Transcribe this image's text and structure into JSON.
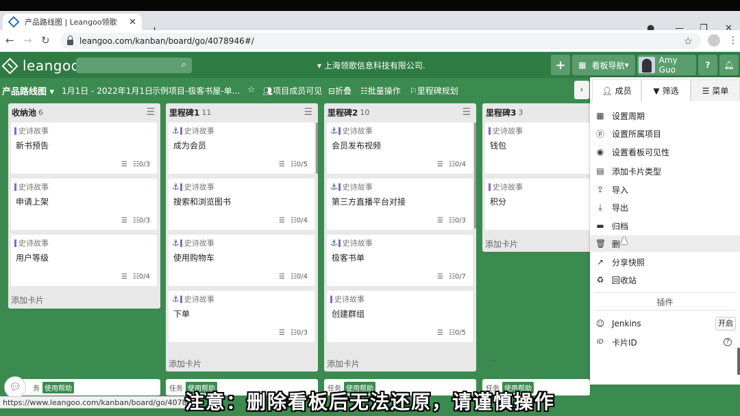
{
  "browser": {
    "tab_title": "产品路线图 | Leangoo领歌",
    "url": "leangoo.com/kanban/board/go/4078946#/",
    "status_url": "https://www.leangoo.com/kanban/board/go/40789"
  },
  "header": {
    "logo_text": "leangoo",
    "company": "上海领歌信息科技有限公司.",
    "board_nav_label": "看板导航",
    "user_name": "Amy Guo"
  },
  "subbar": {
    "board_title": "产品路线图",
    "date_range": "1月1日 - 2022年1月1日",
    "project": "示例项目-极客书屋-单...",
    "members_visible": "项目成员可见",
    "fold": "折叠",
    "batch": "批量操作",
    "milestone": "里程碑规划"
  },
  "columns": [
    {
      "name": "收纳池",
      "count": "6",
      "cards": [
        {
          "tag": "史诗故事",
          "title": "新书预告",
          "tasks": "0/3",
          "anchor": false
        },
        {
          "tag": "史诗故事",
          "title": "申请上架",
          "tasks": "0/3",
          "anchor": false
        },
        {
          "tag": "史诗故事",
          "title": "用户等级",
          "tasks": "0/4",
          "anchor": false
        }
      ],
      "add_card": "添加卡片"
    },
    {
      "name": "里程碑1",
      "count": "11",
      "cards": [
        {
          "tag": "史诗故事",
          "title": "成为会员",
          "tasks": "0/5",
          "anchor": true
        },
        {
          "tag": "史诗故事",
          "title": "搜索和浏览图书",
          "tasks": "0/4",
          "anchor": true
        },
        {
          "tag": "史诗故事",
          "title": "使用购物车",
          "tasks": "0/4",
          "anchor": true
        },
        {
          "tag": "史诗故事",
          "title": "下单",
          "tasks": "0/3",
          "anchor": true
        }
      ],
      "add_card": "添加卡片"
    },
    {
      "name": "里程碑2",
      "count": "10",
      "cards": [
        {
          "tag": "史诗故事",
          "title": "会员发布视频",
          "tasks": "0/4",
          "anchor": true
        },
        {
          "tag": "史诗故事",
          "title": "第三方直播平台对接",
          "tasks": "0/3",
          "anchor": true
        },
        {
          "tag": "史诗故事",
          "title": "极客书单",
          "tasks": "0/7",
          "anchor": true
        },
        {
          "tag": "史诗故事",
          "title": "创建群组",
          "tasks": "0/5",
          "anchor": false
        }
      ],
      "add_card": "添加卡片"
    },
    {
      "name": "里程碑3",
      "count": "3",
      "cards": [
        {
          "tag": "史诗故事",
          "title": "钱包",
          "tasks": "",
          "anchor": false
        },
        {
          "tag": "史诗故事",
          "title": "积分",
          "tasks": "",
          "anchor": false
        }
      ],
      "add_card": "添加卡片"
    }
  ],
  "bottom_cards": {
    "type_label": "任务",
    "badge": "使用帮助",
    "first_prefix": "务"
  },
  "panel": {
    "tabs": [
      "成员",
      "筛选",
      "菜单"
    ],
    "menu": [
      {
        "icon": "calendar-icon",
        "label": "设置周期"
      },
      {
        "icon": "project-icon",
        "label": "设置所属项目"
      },
      {
        "icon": "eye-icon",
        "label": "设置看板可见性"
      },
      {
        "icon": "card-type-icon",
        "label": "添加卡片类型"
      },
      {
        "icon": "upload-icon",
        "label": "导入"
      },
      {
        "icon": "download-icon",
        "label": "导出"
      },
      {
        "icon": "archive-icon",
        "label": "归档"
      },
      {
        "icon": "trash-icon",
        "label": "删"
      },
      {
        "icon": "share-icon",
        "label": "分享快照"
      },
      {
        "icon": "recycle-icon",
        "label": "回收站"
      }
    ],
    "plugins_title": "插件",
    "plugins": [
      {
        "icon": "jenkins-icon",
        "label": "Jenkins",
        "toggle": "开启"
      },
      {
        "icon": "id-icon",
        "label": "卡片ID",
        "toggle": ""
      }
    ]
  },
  "subtitle": "注意：删除看板后无法还原，请谨慎操作"
}
